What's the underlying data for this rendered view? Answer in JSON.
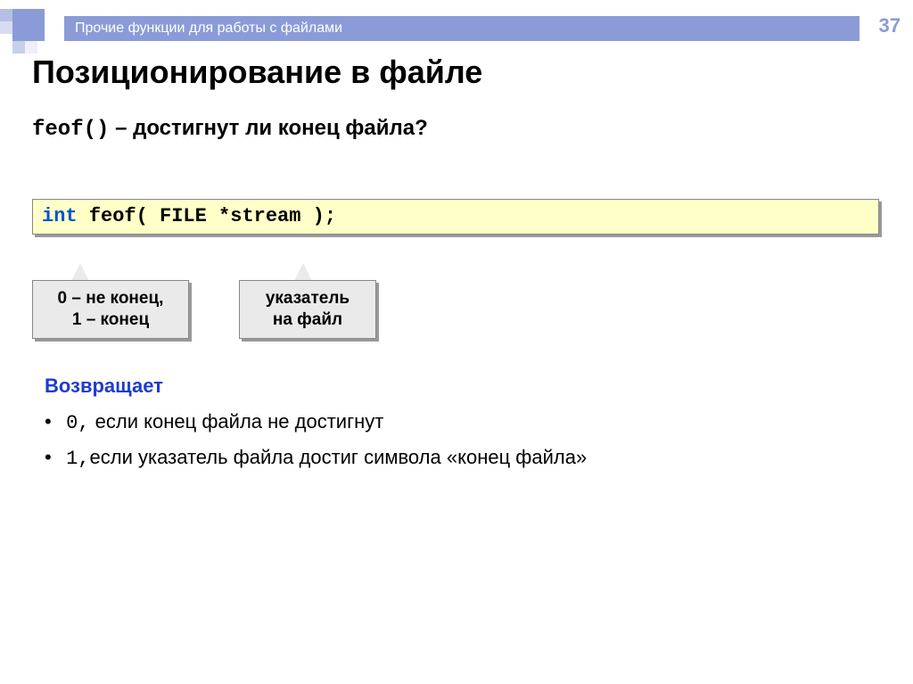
{
  "page_number": "37",
  "topbar_title": "Прочие функции для работы с файлами",
  "heading": "Позиционирование в файле",
  "subheading_code": "feof()",
  "subheading_rest": " – достигнут ли конец файла?",
  "signature": {
    "kw1": "int",
    "mid": " feof( FILE *stream );"
  },
  "callout1_line1": "0 – не конец,",
  "callout1_line2": "1 – конец",
  "callout2_line1": "указатель",
  "callout2_line2": "на файл",
  "returns_label": "Возвращает",
  "bullet1_code": "0,",
  "bullet1_text": " если конец файла не достигнут",
  "bullet2_code": "1,",
  "bullet2_text": "если указатель файла достиг символа «конец файла»"
}
